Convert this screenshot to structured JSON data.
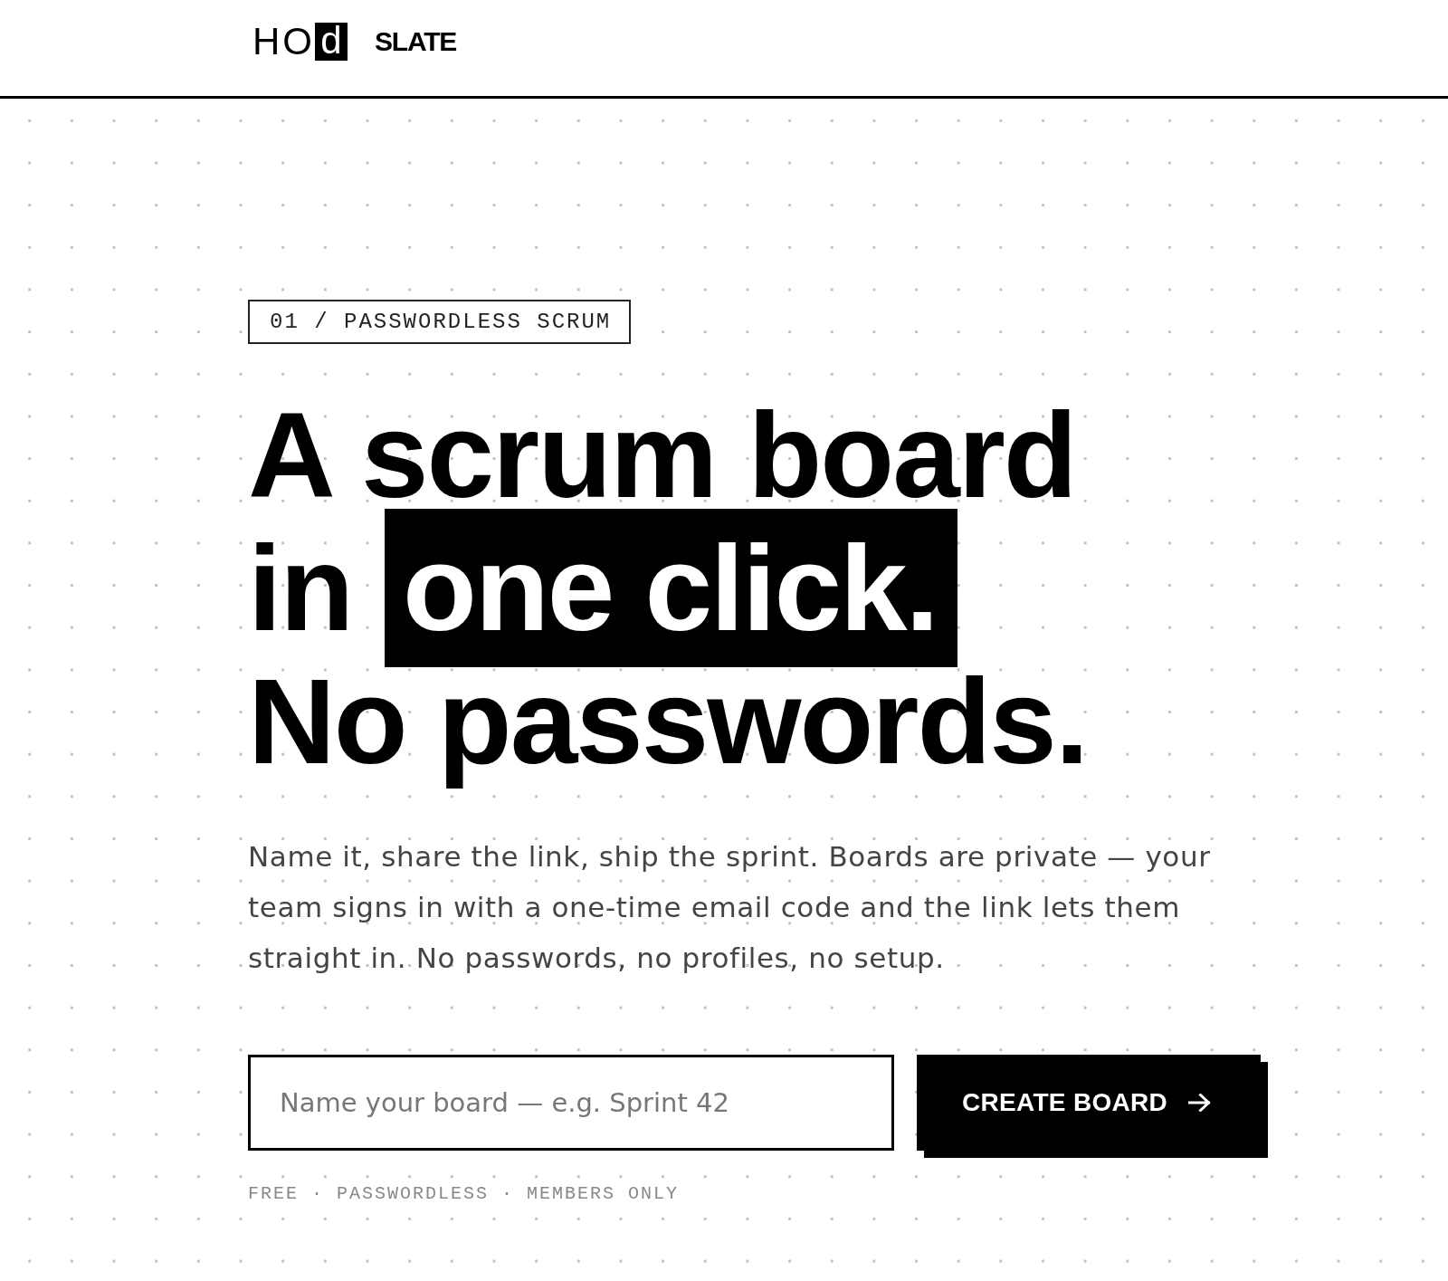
{
  "header": {
    "logo": {
      "text": "HO",
      "boxed_letter": "d"
    },
    "product_name": "SLATE"
  },
  "hero": {
    "eyebrow": "01 / PASSWORDLESS SCRUM",
    "headline_lines": [
      {
        "segments": [
          {
            "text": "A scrum board",
            "highlighted": false
          }
        ]
      },
      {
        "segments": [
          {
            "text": "in",
            "highlighted": false
          },
          {
            "text": "one click.",
            "highlighted": true
          }
        ]
      },
      {
        "segments": [
          {
            "text": "No passwords.",
            "highlighted": false
          }
        ]
      }
    ],
    "description": "Name it, share the link, ship the sprint. Boards are private — your team signs in with a one-time email code and the link lets them straight in. No passwords, no profiles, no setup.",
    "board_name_input": {
      "placeholder": "Name your board — e.g. Sprint 42"
    },
    "create_button": {
      "label": "CREATE BOARD"
    },
    "features": "FREE · PASSWORDLESS · MEMBERS ONLY"
  }
}
